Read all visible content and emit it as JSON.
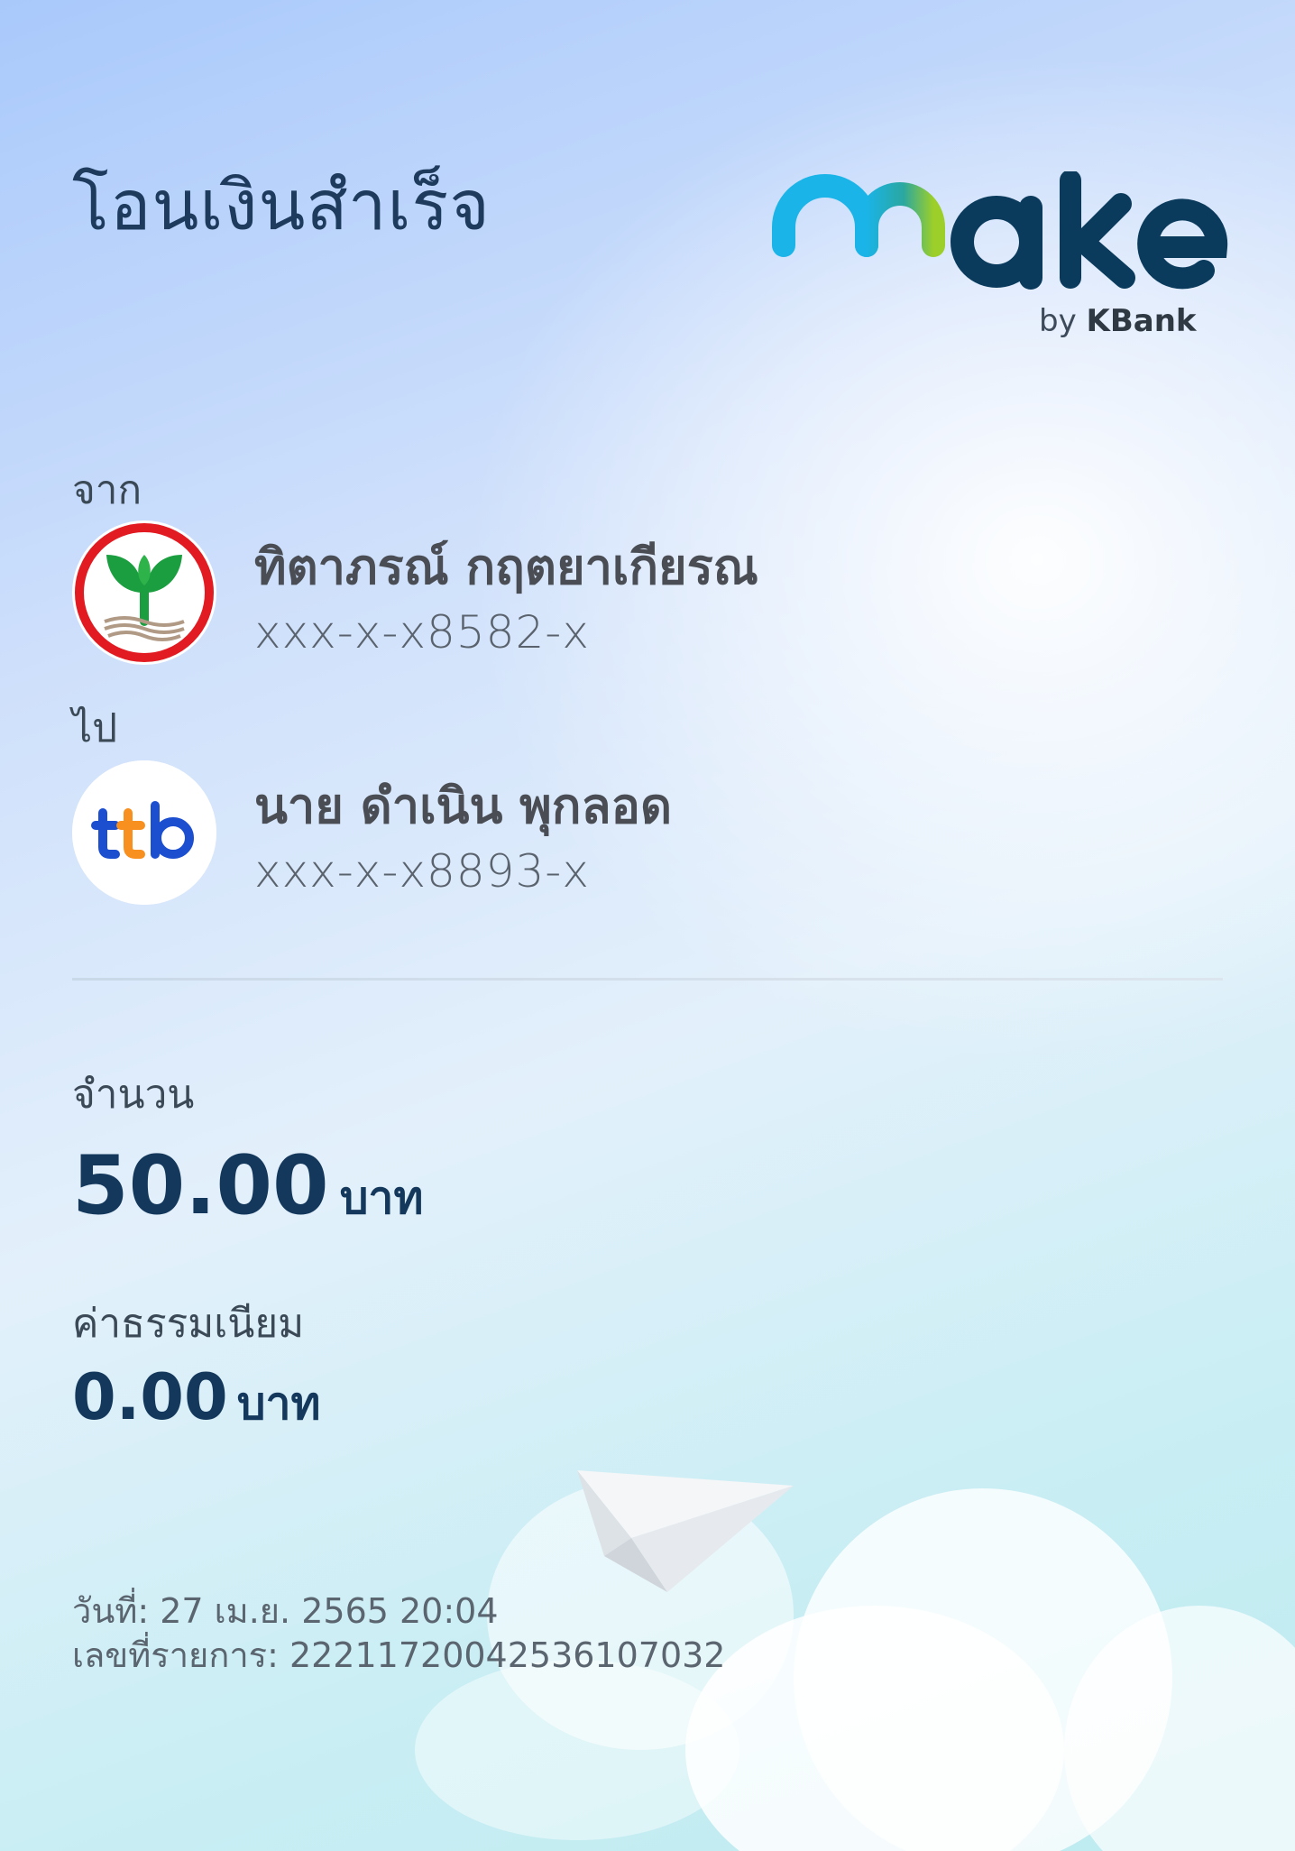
{
  "title": "โอนเงินสำเร็จ",
  "brand": {
    "logo_text": "make",
    "by_prefix": "by",
    "by_bank": "KBank"
  },
  "from": {
    "label": "จาก",
    "bank_icon": "kbank-logo",
    "name": "ทิตาภรณ์ กฤตยาเกียรณ",
    "account": "xxx-x-x8582-x"
  },
  "to": {
    "label": "ไป",
    "bank_icon": "ttb-logo",
    "bank_logo_text": "ttb",
    "name": "นาย ดำเนิน พุกลอด",
    "account": "xxx-x-x8893-x"
  },
  "amount": {
    "label": "จำนวน",
    "value": "50.00",
    "currency": "บาท"
  },
  "fee": {
    "label": "ค่าธรรมเนียม",
    "value": "0.00",
    "currency": "บาท"
  },
  "date_line": "วันที่: 27 เม.ย. 2565 20:04",
  "ref_line": "เลขที่รายการ: 2221172004253610703​2",
  "colors": {
    "primary_text": "#14385c",
    "kbank_green": "#1a9e3f",
    "kbank_red": "#e21b22",
    "ttb_blue": "#1b4fd0",
    "ttb_orange": "#f7901e"
  }
}
